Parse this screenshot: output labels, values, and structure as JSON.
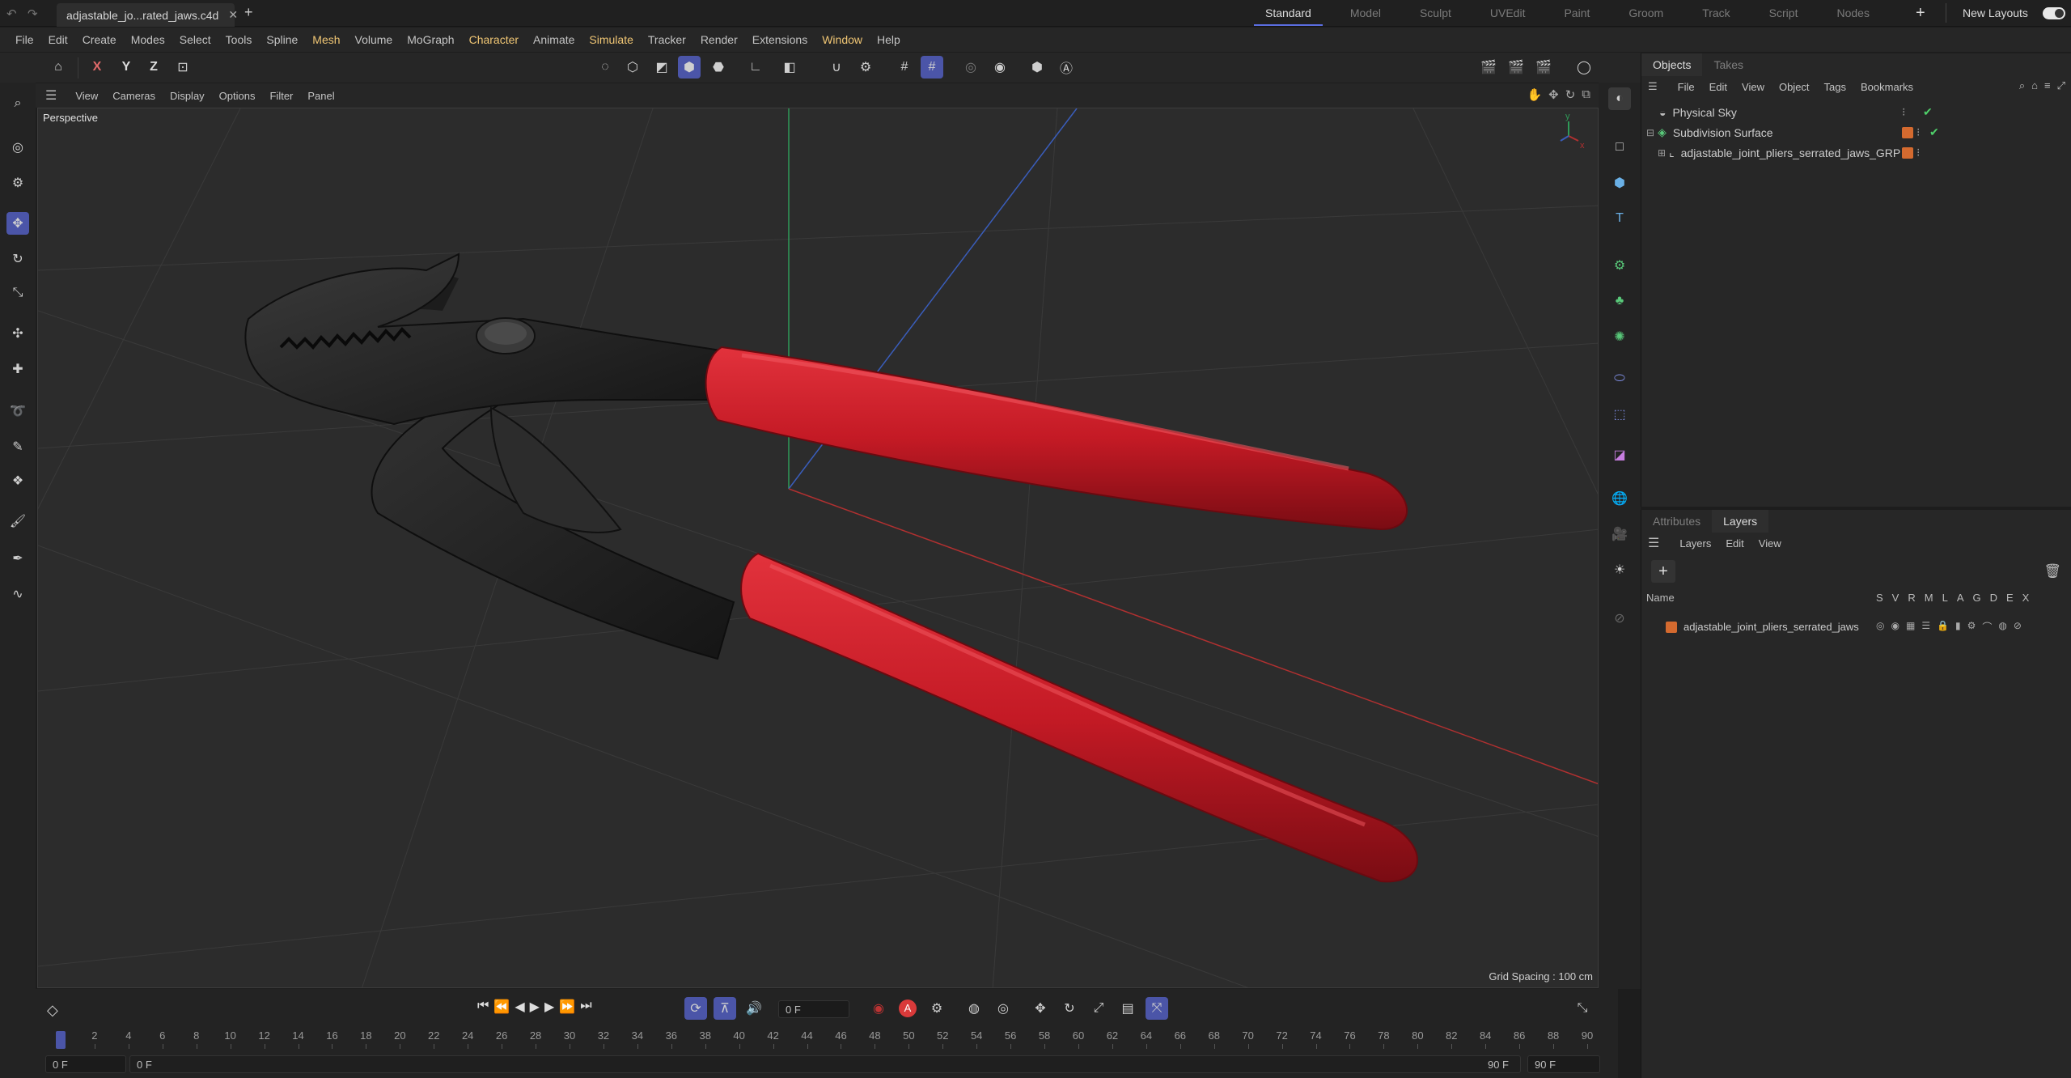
{
  "titlebar": {
    "doc_tab": "adjastable_jo...rated_jaws.c4d",
    "add_tab": "+",
    "layouts": [
      "Standard",
      "Model",
      "Sculpt",
      "UVEdit",
      "Paint",
      "Groom",
      "Track",
      "Script",
      "Nodes"
    ],
    "new_layouts": "New Layouts"
  },
  "menubar": [
    "File",
    "Edit",
    "Create",
    "Modes",
    "Select",
    "Tools",
    "Spline",
    "Mesh",
    "Volume",
    "MoGraph",
    "Character",
    "Animate",
    "Simulate",
    "Tracker",
    "Render",
    "Extensions",
    "Window",
    "Help"
  ],
  "toolbar": {
    "x": "X",
    "y": "Y",
    "z": "Z"
  },
  "viewport_menu": [
    "View",
    "Cameras",
    "Display",
    "Options",
    "Filter",
    "Panel"
  ],
  "viewport": {
    "camera_label": "Perspective",
    "grid_spacing": "Grid Spacing : 100 cm",
    "axis_y": "y",
    "axis_x": "x",
    "colors": {
      "handles": "#c41a25",
      "metal": "#1f1f1f",
      "axis_x": "#b03030",
      "axis_y": "#2f9a58",
      "axis_z": "#3a5dbb"
    }
  },
  "objects_panel": {
    "tabs": [
      "Objects",
      "Takes"
    ],
    "menu": [
      "File",
      "Edit",
      "View",
      "Object",
      "Tags",
      "Bookmarks"
    ],
    "items": [
      {
        "name": "Physical Sky",
        "indent": 0
      },
      {
        "name": "Subdivision Surface",
        "indent": 0
      },
      {
        "name": "adjastable_joint_pliers_serrated_jaws_GRP",
        "indent": 1
      }
    ]
  },
  "layers_panel": {
    "tabs": [
      "Attributes",
      "Layers"
    ],
    "menu": [
      "Layers",
      "Edit",
      "View"
    ],
    "add_button": "+",
    "name_header": "Name",
    "flags": [
      "S",
      "V",
      "R",
      "M",
      "L",
      "A",
      "G",
      "D",
      "E",
      "X"
    ],
    "layer": "adjastable_joint_pliers_serrated_jaws"
  },
  "timeline": {
    "frame_field": "0 F",
    "ticks": [
      "0",
      "2",
      "4",
      "6",
      "8",
      "10",
      "12",
      "14",
      "16",
      "18",
      "20",
      "22",
      "24",
      "26",
      "28",
      "30",
      "32",
      "34",
      "36",
      "38",
      "40",
      "42",
      "44",
      "46",
      "48",
      "50",
      "52",
      "54",
      "56",
      "58",
      "60",
      "62",
      "64",
      "66",
      "68",
      "70",
      "72",
      "74",
      "76",
      "78",
      "80",
      "82",
      "84",
      "86",
      "88",
      "90"
    ],
    "start": "0 F",
    "range_start": "0 F",
    "range_end": "90 F",
    "end": "90 F",
    "record_label": "A"
  }
}
